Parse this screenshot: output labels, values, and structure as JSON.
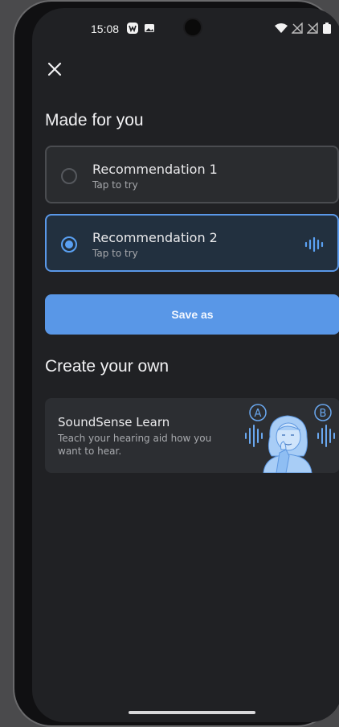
{
  "status_bar": {
    "time": "15:08",
    "icons": [
      "app-badge-icon",
      "image-icon",
      "wifi-icon",
      "no-signal-icon",
      "no-signal-icon",
      "battery-icon"
    ]
  },
  "header": {
    "close_icon": "close-icon"
  },
  "made_for_you": {
    "title": "Made for you",
    "options": [
      {
        "title": "Recommendation 1",
        "subtitle": "Tap to try",
        "selected": false
      },
      {
        "title": "Recommendation 2",
        "subtitle": "Tap to try",
        "selected": true,
        "playing_icon": "sound-wave-icon"
      }
    ],
    "save_label": "Save as"
  },
  "create_your_own": {
    "title": "Create your own",
    "card": {
      "title": "SoundSense Learn",
      "description": "Teach your hearing aid how you want to hear.",
      "badge_a": "A",
      "badge_b": "B"
    }
  },
  "colors": {
    "accent": "#5a98e8",
    "background": "#202124",
    "card": "#2a2c2f"
  }
}
